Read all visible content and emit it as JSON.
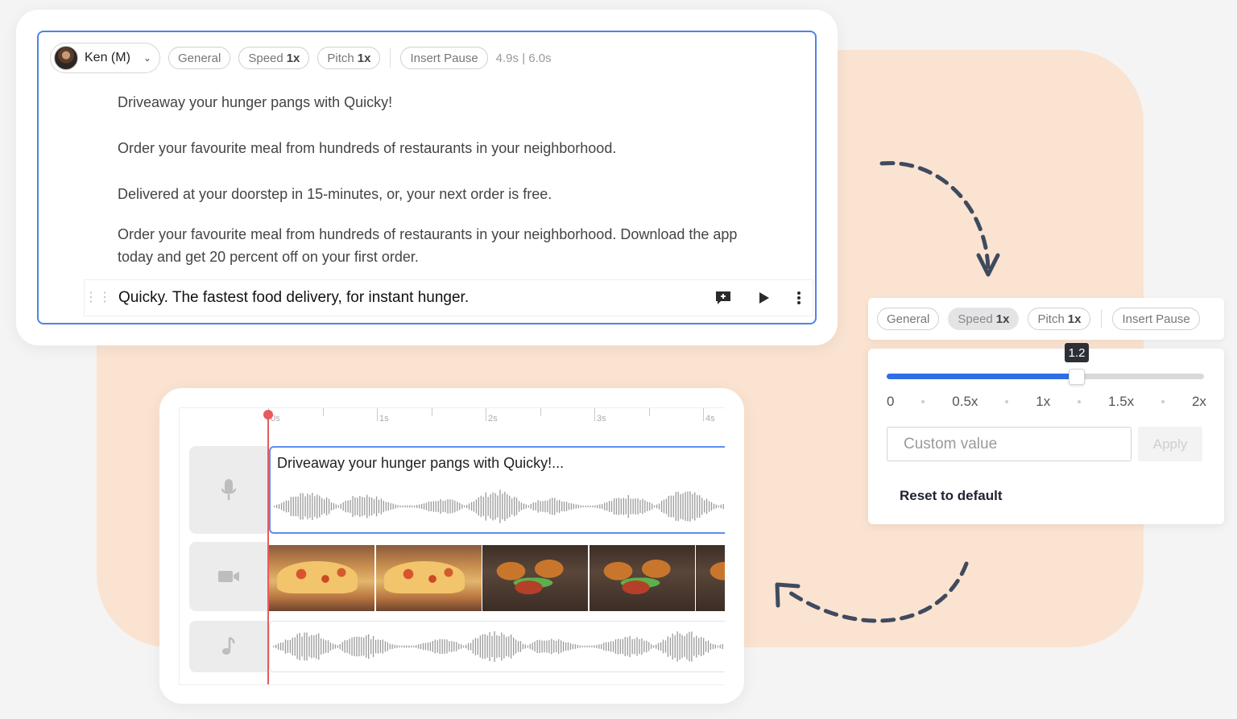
{
  "editor": {
    "voice_name": "Ken (M)",
    "tabs": [
      {
        "label": "General",
        "value": ""
      },
      {
        "label": "Speed",
        "value": "1x"
      },
      {
        "label": "Pitch",
        "value": "1x"
      }
    ],
    "insert_pause_label": "Insert Pause",
    "timing": "4.9s | 6.0s",
    "paragraphs": [
      "Driveaway your hunger pangs with Quicky!",
      "Order your favourite meal from hundreds of restaurants in your neighborhood.",
      "Delivered at your doorstep in 15-minutes, or, your next order is free.",
      "Order your favourite meal from hundreds of restaurants in your neighborhood. Download the app today and get 20 percent off on your first order."
    ],
    "active_line": "Quicky. The fastest food delivery, for instant hunger."
  },
  "speed_panel": {
    "tabs": [
      {
        "label": "General",
        "value": ""
      },
      {
        "label": "Speed",
        "value": "1x",
        "active": true
      },
      {
        "label": "Pitch",
        "value": "1x"
      }
    ],
    "insert_pause_label": "Insert Pause",
    "slider_value": "1.2",
    "slider_min": 0,
    "slider_max": 2,
    "tick_labels": [
      "0",
      "0.5x",
      "1x",
      "1.5x",
      "2x"
    ],
    "custom_placeholder": "Custom value",
    "apply_label": "Apply",
    "reset_label": "Reset to default",
    "accent_color": "#2f6ee6"
  },
  "timeline": {
    "ruler_labels": [
      "0s",
      "1s",
      "2s",
      "3s",
      "4s"
    ],
    "voice_clip_title": "Driveaway your hunger pangs with Quicky!...",
    "tracks": [
      {
        "icon": "microphone-icon"
      },
      {
        "icon": "video-camera-icon"
      },
      {
        "icon": "music-note-icon"
      }
    ],
    "video_frames": [
      "pizza",
      "pizza",
      "hotdog-burger",
      "hotdog-burger",
      "hotdog-burger"
    ],
    "playhead_color": "#e85b5b"
  }
}
